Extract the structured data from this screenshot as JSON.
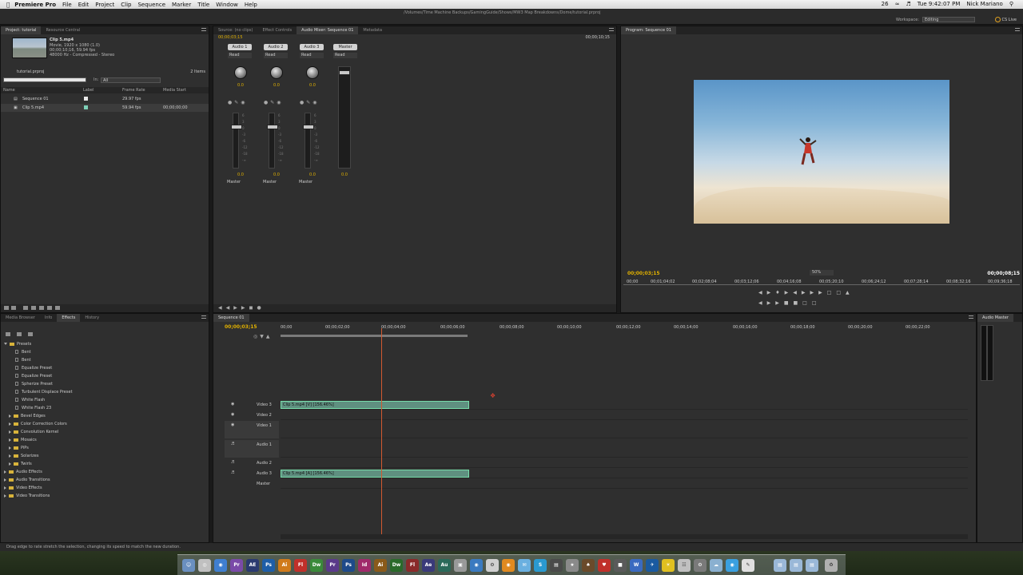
{
  "menubar": {
    "app": "Premiere Pro",
    "items": [
      "File",
      "Edit",
      "Project",
      "Clip",
      "Sequence",
      "Marker",
      "Title",
      "Window",
      "Help"
    ],
    "clock": "Tue 9:42:07 PM",
    "user": "Nick Mariano",
    "battery": "26"
  },
  "titlebar": {
    "path": "/Volumes/Time Machine Backups/GamingGuide/Shows/MW3 Map Breakdowns/Dome/tutorial.prproj",
    "workspace_label": "Workspace:",
    "workspace_value": "Editing",
    "cs_live": "CS Live"
  },
  "project": {
    "tabs": [
      "Project: tutorial",
      "Resource Central"
    ],
    "clip_name": "Clip 5.mp4",
    "clip_line1": "Movie, 1920 x 1080 (1.0)",
    "clip_line2": "00;00;10;16, 59.94 fps",
    "clip_line3": "48000 Hz - Compressed - Stereo",
    "file": "tutorial.prproj",
    "count": "2 Items",
    "in_label": "In:",
    "in_value": "All",
    "columns": [
      "Name",
      "Label",
      "Frame Rate",
      "Media Start"
    ],
    "rows": [
      {
        "name": "Sequence 01",
        "rate": "29.97 fps",
        "start": "",
        "label_color": "#e8e8e8"
      },
      {
        "name": "Clip 5.mp4",
        "rate": "59.94 fps",
        "start": "00;00;00;00",
        "label_color": "#7ed0b8"
      }
    ]
  },
  "mixer": {
    "tabs": [
      "Source: (no clips)",
      "Effect Controls",
      "Audio Mixer: Sequence 01",
      "Metadata"
    ],
    "timecode": "00;00;03;15",
    "timecode_right": "00;00;10;15",
    "channels": [
      "Audio 1",
      "Audio 2",
      "Audio 3",
      "Master"
    ],
    "mode": "Read",
    "knob_value": "0.0",
    "fader_value": "0.0",
    "output": "Master"
  },
  "program": {
    "tab": "Program: Sequence 01",
    "timecode": "00;00;03;15",
    "duration": "00;00;08;15",
    "zoom": "50%",
    "ruler": [
      "00;00",
      "00;01;04;02",
      "00;02;08;04",
      "00;03;12;06",
      "00;04;16;08",
      "00;05;20;10",
      "00;06;24;12",
      "00;07;28;14",
      "00;08;32;16",
      "00;09;36;18"
    ]
  },
  "effects": {
    "tabs": [
      "Media Browser",
      "Info",
      "Effects",
      "History"
    ],
    "presets_label": "Presets",
    "presets": [
      "Bent",
      "Bent",
      "Equalize Preset",
      "Equalize Preset",
      "Spherize Preset",
      "Turbulent Displace Preset",
      "White Flash",
      "White Flash 23"
    ],
    "subfolders": [
      "Bevel Edges",
      "Color Correction Colors",
      "Convolution Kernel",
      "Mosaics",
      "PiPs",
      "Solarizes",
      "Twirls"
    ],
    "categories": [
      "Audio Effects",
      "Audio Transitions",
      "Video Effects",
      "Video Transitions"
    ]
  },
  "timeline": {
    "tab": "Sequence 01",
    "timecode": "00;00;03;15",
    "ruler": [
      "00;00",
      "00;00;02;00",
      "00;00;04;00",
      "00;00;06;00",
      "00;00;08;00",
      "00;00;10;00",
      "00;00;12;00",
      "00;00;14;00",
      "00;00;16;00",
      "00;00;18;00",
      "00;00;20;00",
      "00;00;22;00"
    ],
    "video_tracks": [
      "Video 3",
      "Video 2",
      "Video 1"
    ],
    "audio_tracks": [
      "Audio 1",
      "Audio 2",
      "Audio 3",
      "Master"
    ],
    "video_clip": "Clip 5.mp4 [V] [156.46%]",
    "audio_clip": "Clip 5.mp4 [A] [156.46%]"
  },
  "audio_master": {
    "tab": "Audio Master"
  },
  "status": {
    "text": "Drag edge to rate stretch the selection, changing its speed to match the new duration."
  },
  "dock": {
    "icons": [
      "Pr",
      "AE",
      "Ps",
      "Ai",
      "Fl",
      "Dw",
      "Pr",
      "Ps",
      "Id",
      "Ai",
      "Dw",
      "Fl",
      "Ae",
      "Au"
    ]
  }
}
